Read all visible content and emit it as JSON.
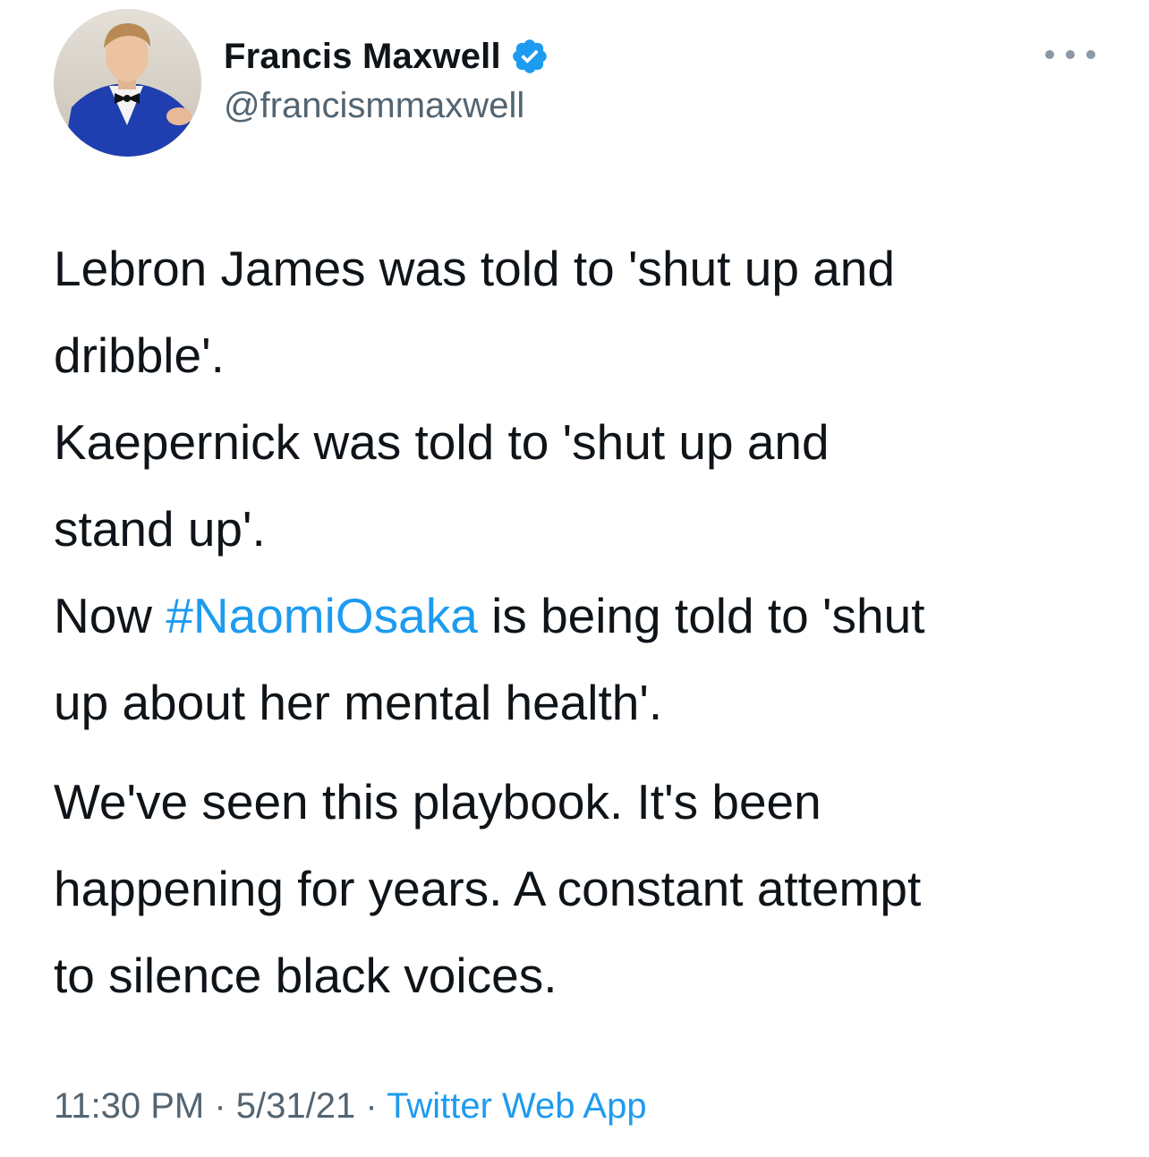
{
  "author": {
    "display_name": "Francis Maxwell",
    "handle": "@francismmaxwell",
    "verified": true,
    "verified_icon": "verified-badge-icon"
  },
  "more_icon": "more-options-icon",
  "tweet": {
    "line1a": "Lebron James was told to 'shut up and",
    "line1b": "dribble'.",
    "line2a": "Kaepernick was told to 'shut up and",
    "line2b": "stand up'.",
    "line3_prefix": "Now ",
    "hashtag": "#NaomiOsaka",
    "line3_suffix": " is being told to 'shut",
    "line3b": "up about her mental health'.",
    "para2_line1": "We've seen this playbook. It's been",
    "para2_line2": "happening for years. A constant attempt",
    "para2_line3": "to silence black voices."
  },
  "meta": {
    "time": "11:30 PM",
    "sep1": " · ",
    "date": "5/31/21",
    "sep2": " · ",
    "source": "Twitter Web App"
  },
  "colors": {
    "link": "#1d9bf0",
    "text": "#0f1419",
    "secondary": "#536471"
  }
}
